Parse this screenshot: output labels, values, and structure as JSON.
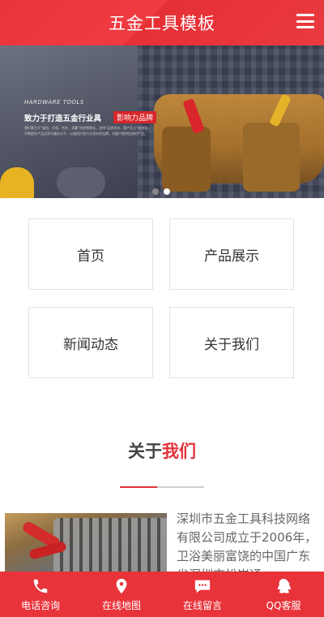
{
  "header": {
    "title": "五金工具模板",
    "menu_icon": "hamburger-menu-icon"
  },
  "banner": {
    "subtitle": "HARDWARE TOOLS",
    "headline": "致力于打造五金行业具",
    "highlight": "影响力品牌",
    "description": "我们致力于“诚信、开拓、合作、双赢”的经营理念，坚持“品质优先、客户至上”的宗旨，不断提升产品品质与服务水平，以诚信打造行业领先的品牌，为客户提供优质的产品。",
    "slides": 2,
    "active_slide": 2
  },
  "nav": {
    "items": [
      {
        "label": "首页"
      },
      {
        "label": "产品展示"
      },
      {
        "label": "新闻动态"
      },
      {
        "label": "关于我们"
      }
    ]
  },
  "about": {
    "title_part1": "关于",
    "title_part2": "我们",
    "text": "深圳市五金工具科技网络有限公司成立于2006年，卫浴美丽富饶的中国广东省深圳市松岗通"
  },
  "footer": {
    "items": [
      {
        "label": "电话咨询",
        "icon": "phone-icon"
      },
      {
        "label": "在线地图",
        "icon": "map-pin-icon"
      },
      {
        "label": "在线留言",
        "icon": "message-icon"
      },
      {
        "label": "QQ客服",
        "icon": "qq-icon"
      }
    ]
  },
  "colors": {
    "accent": "#e8333a",
    "text": "#333333",
    "muted": "#666666"
  }
}
